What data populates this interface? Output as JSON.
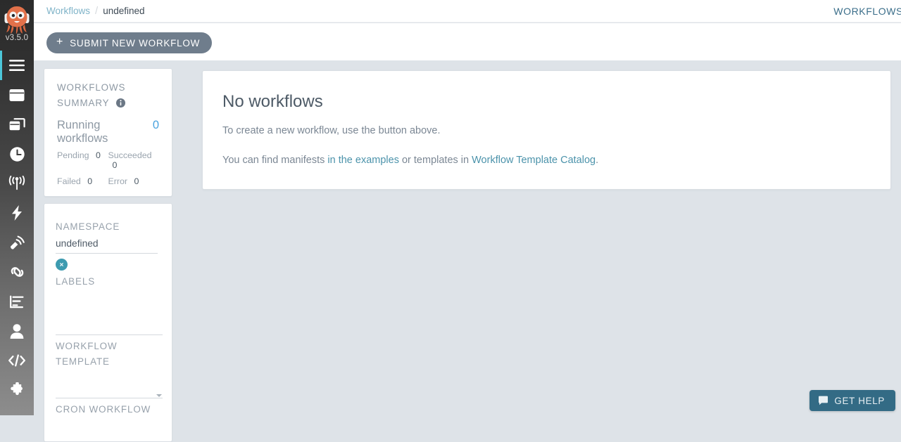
{
  "app": {
    "version": "v3.5.0",
    "accent_teal": "#4cc6d9",
    "link_color": "#4c93ab",
    "background": "#dee3e8"
  },
  "left_nav": {
    "logo_icon": "argo-octopus-logo-icon",
    "items": [
      {
        "icon": "hamburger-menu-icon",
        "name": "sidebar-item-menu",
        "active": true
      },
      {
        "icon": "workflows-icon",
        "name": "sidebar-item-workflows",
        "active": false
      },
      {
        "icon": "workflow-templates-icon",
        "name": "sidebar-item-workflow-templates",
        "active": false
      },
      {
        "icon": "cron-workflows-clock-icon",
        "name": "sidebar-item-cron-workflows",
        "active": false
      },
      {
        "icon": "event-sources-antenna-icon",
        "name": "sidebar-item-event-sources",
        "active": false
      },
      {
        "icon": "sensors-bolt-icon",
        "name": "sidebar-item-sensors",
        "active": false
      },
      {
        "icon": "event-flow-satellite-icon",
        "name": "sidebar-item-event-flow",
        "active": false
      },
      {
        "icon": "pipelines-link-icon",
        "name": "sidebar-item-pipelines",
        "active": false
      },
      {
        "icon": "reports-bar-chart-icon",
        "name": "sidebar-item-reports",
        "active": false
      },
      {
        "icon": "user-icon",
        "name": "sidebar-item-user",
        "active": false
      },
      {
        "icon": "api-docs-code-icon",
        "name": "sidebar-item-api-docs",
        "active": false
      },
      {
        "icon": "plugins-puzzle-icon",
        "name": "sidebar-item-plugins",
        "active": false
      }
    ]
  },
  "header": {
    "breadcrumb": {
      "root": "Workflows",
      "separator": "/",
      "current": "undefined"
    },
    "title_right": "WORKFLOWS"
  },
  "action_bar": {
    "submit_plus": "+",
    "submit_label": "SUBMIT NEW WORKFLOW"
  },
  "summary_card": {
    "heading_line1": "WORKFLOWS",
    "heading_line2": "SUMMARY",
    "info_icon": "info-circle-icon",
    "running_label": "Running workflows",
    "running_count": "0",
    "stats": [
      {
        "label": "Pending",
        "value": "0"
      },
      {
        "label": "Succeeded",
        "value": "0"
      },
      {
        "label": "Failed",
        "value": "0"
      },
      {
        "label": "Error",
        "value": "0"
      }
    ]
  },
  "filters_card": {
    "namespace_label": "NAMESPACE",
    "namespace_value": "undefined",
    "namespace_placeholder": "",
    "namespace_clear_icon": "close-x-icon",
    "labels_label": "LABELS",
    "labels_value": "",
    "labels_placeholder": "",
    "template_label_line1": "WORKFLOW",
    "template_label_line2": "TEMPLATE",
    "template_value": "",
    "template_placeholder": "",
    "cron_label": "CRON WORKFLOW"
  },
  "main_panel": {
    "title": "No workflows",
    "line1": "To create a new workflow, use the button above.",
    "line2_prefix": "You can find manifests ",
    "line2_link1": "in the examples",
    "line2_middle": " or templates in ",
    "line2_link2": "Workflow Template Catalog",
    "line2_suffix": "."
  },
  "get_help": {
    "icon": "chat-bubble-icon",
    "label": "GET HELP"
  }
}
